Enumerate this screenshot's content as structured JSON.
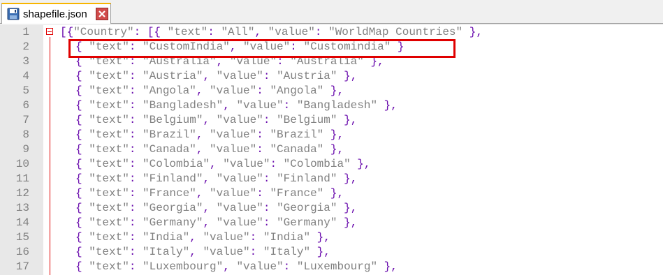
{
  "tab": {
    "title": "shapefile.json",
    "icon": "json-file-icon",
    "close_icon": "close-icon"
  },
  "colors": {
    "brace": "#6a0dad",
    "string": "#808080",
    "line_number": "#808080",
    "highlight": "#e00000"
  },
  "lines": [
    {
      "n": "1",
      "code": "[{\"Country\": [{ \"text\": \"All\", \"value\": \"WorldMap Countries\" },"
    },
    {
      "n": "2",
      "code": "{ \"text\": \"CustomIndia\", \"value\": \"Customindia\" }"
    },
    {
      "n": "3",
      "code": "{ \"text\": \"Australia\", \"value\": \"Australia\" },"
    },
    {
      "n": "4",
      "code": "{ \"text\": \"Austria\", \"value\": \"Austria\" },"
    },
    {
      "n": "5",
      "code": "{ \"text\": \"Angola\", \"value\": \"Angola\" },"
    },
    {
      "n": "6",
      "code": "{ \"text\": \"Bangladesh\", \"value\": \"Bangladesh\" },"
    },
    {
      "n": "7",
      "code": "{ \"text\": \"Belgium\", \"value\": \"Belgium\" },"
    },
    {
      "n": "8",
      "code": "{ \"text\": \"Brazil\", \"value\": \"Brazil\" },"
    },
    {
      "n": "9",
      "code": "{ \"text\": \"Canada\", \"value\": \"Canada\" },"
    },
    {
      "n": "10",
      "code": "{ \"text\": \"Colombia\", \"value\": \"Colombia\" },"
    },
    {
      "n": "11",
      "code": "{ \"text\": \"Finland\", \"value\": \"Finland\" },"
    },
    {
      "n": "12",
      "code": "{ \"text\": \"France\", \"value\": \"France\" },"
    },
    {
      "n": "13",
      "code": "{ \"text\": \"Georgia\", \"value\": \"Georgia\" },"
    },
    {
      "n": "14",
      "code": "{ \"text\": \"Germany\", \"value\": \"Germany\" },"
    },
    {
      "n": "15",
      "code": "{ \"text\": \"India\", \"value\": \"India\" },"
    },
    {
      "n": "16",
      "code": "{ \"text\": \"Italy\", \"value\": \"Italy\" },"
    },
    {
      "n": "17",
      "code": "{ \"text\": \"Luxembourg\", \"value\": \"Luxembourg\" },"
    }
  ]
}
